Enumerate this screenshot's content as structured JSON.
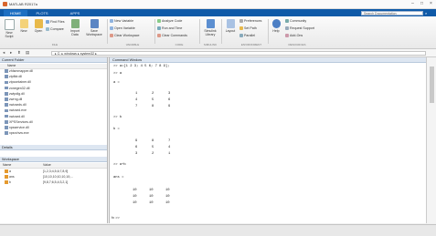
{
  "window": {
    "title": "MATLAB R2017a"
  },
  "tabs": [
    "HOME",
    "PLOTS",
    "APPS"
  ],
  "search": {
    "placeholder": "Search Documentation"
  },
  "ribbon": {
    "file": {
      "new_script": "New Script",
      "new": "New",
      "open": "Open",
      "find_files": "Find Files",
      "compare": "Compare",
      "import_data": "Import Data",
      "save_workspace": "Save Workspace",
      "group": "FILE"
    },
    "variable": {
      "new_variable": "New Variable",
      "open_variable": "Open Variable",
      "clear_workspace": "Clear Workspace",
      "group": "VARIABLE"
    },
    "code": {
      "analyze_code": "Analyze Code",
      "run_and_time": "Run and Time",
      "clear_commands": "Clear Commands",
      "group": "CODE"
    },
    "simulink": {
      "simulink": "Simulink Library",
      "group": "SIMULINK"
    },
    "environment": {
      "layout": "Layout",
      "preferences": "Preferences",
      "set_path": "Set Path",
      "parallel": "Parallel",
      "group": "ENVIRONMENT"
    },
    "resources": {
      "help": "Help",
      "community": "Community",
      "request_support": "Request Support",
      "add_ons": "Add-Ons",
      "group": "RESOURCES"
    }
  },
  "address": {
    "path": "▸ C: ▸ windows ▸ system32 ▸"
  },
  "current_folder": {
    "title": "Current Folder",
    "column": "Name",
    "files": [
      "zhlsmmapper.dll",
      "zipfldr.dll",
      "zipcontainer.dll",
      "zonegen32.dll",
      "zwtpdlg.dll",
      "zwrng.dll",
      "xwizards.dll",
      "xwizard.exe",
      "xwizard.dll",
      "XPSServices.dll",
      "xpsservice.dll",
      "xpsrchvw.exe"
    ]
  },
  "details": {
    "title": "Details"
  },
  "workspace": {
    "title": "Workspace",
    "col_name": "Name",
    "col_value": "Value",
    "vars": [
      {
        "name": "a",
        "value": "[1,2,3;4,5,6;7,8,9]"
      },
      {
        "name": "ans",
        "value": "[10,10,10;10,10,10;..."
      },
      {
        "name": "b",
        "value": "[9,8,7;6,5,4;3,2,1]"
      }
    ]
  },
  "command_window": {
    "title": "Command Window",
    "line1": ">> a=[1 2 3; 4 5 6; 7 8 9];",
    "line2": ">> a",
    "line3": "a =",
    "a_rows": [
      [
        "1",
        "2",
        "3"
      ],
      [
        "4",
        "5",
        "6"
      ],
      [
        "7",
        "8",
        "9"
      ]
    ],
    "line4": ">> b",
    "line5": "b =",
    "b_rows": [
      [
        "9",
        "8",
        "7"
      ],
      [
        "6",
        "5",
        "4"
      ],
      [
        "3",
        "2",
        "1"
      ]
    ],
    "line6": ">> a+b",
    "line7": "ans =",
    "ans_rows": [
      [
        "10",
        "10",
        "10"
      ],
      [
        "10",
        "10",
        "10"
      ],
      [
        "10",
        "10",
        "10"
      ]
    ],
    "prompt": "fx >>"
  }
}
